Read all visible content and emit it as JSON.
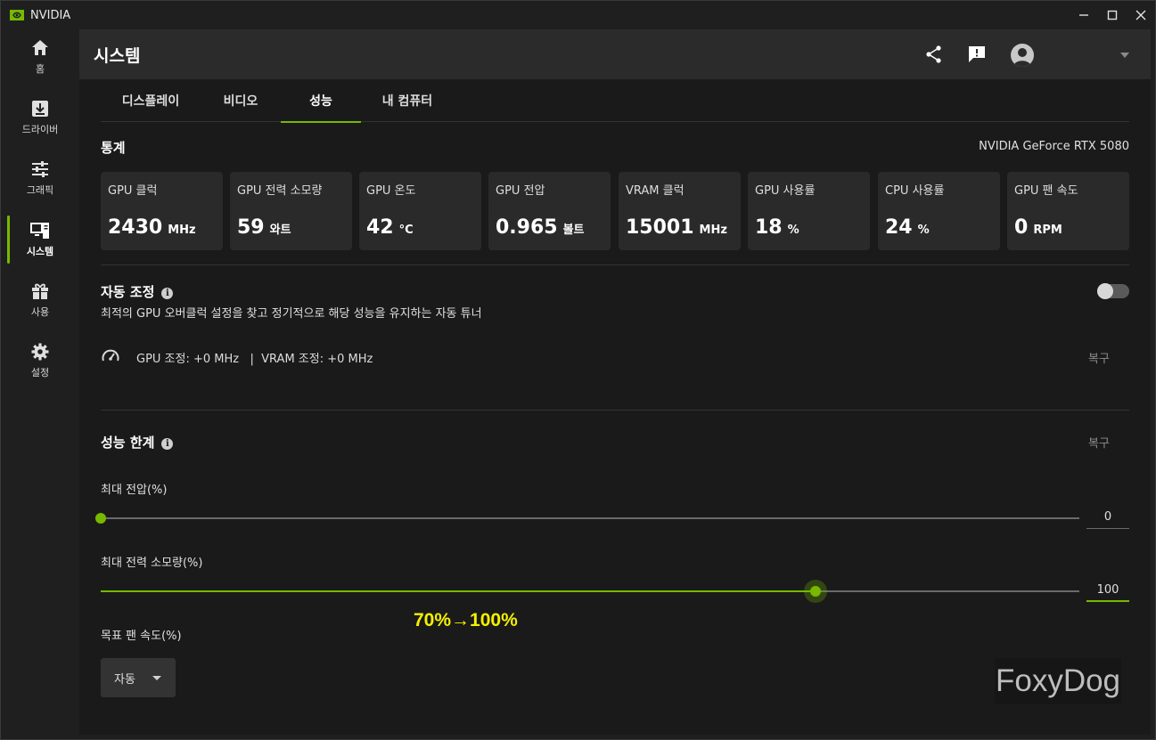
{
  "window": {
    "title": "NVIDIA",
    "controls": [
      "minimize",
      "maximize",
      "close"
    ]
  },
  "nav": {
    "items": [
      {
        "label": "홈",
        "icon": "home-icon",
        "active": false
      },
      {
        "label": "드라이버",
        "icon": "driver-download-icon",
        "active": false
      },
      {
        "label": "그래픽",
        "icon": "sliders-icon",
        "active": false
      },
      {
        "label": "시스템",
        "icon": "system-icon",
        "active": true
      },
      {
        "label": "사용",
        "icon": "gift-icon",
        "active": false
      },
      {
        "label": "설정",
        "icon": "gear-icon",
        "active": false
      }
    ]
  },
  "header": {
    "title": "시스템",
    "icons": [
      "share-icon",
      "feedback-icon",
      "avatar-icon",
      "chevron-down-icon"
    ]
  },
  "tabs": [
    {
      "label": "디스플레이",
      "active": false
    },
    {
      "label": "비디오",
      "active": false
    },
    {
      "label": "성능",
      "active": true
    },
    {
      "label": "내 컴퓨터",
      "active": false
    }
  ],
  "stats": {
    "title": "통계",
    "gpu_name": "NVIDIA GeForce RTX 5080",
    "cards": [
      {
        "label": "GPU 클럭",
        "value": "2430",
        "unit": "MHz"
      },
      {
        "label": "GPU 전력 소모량",
        "value": "59",
        "unit": "와트"
      },
      {
        "label": "GPU 온도",
        "value": "42",
        "unit": "°C"
      },
      {
        "label": "GPU 전압",
        "value": "0.965",
        "unit": "볼트"
      },
      {
        "label": "VRAM 클럭",
        "value": "15001",
        "unit": "MHz"
      },
      {
        "label": "GPU 사용률",
        "value": "18",
        "unit": "%"
      },
      {
        "label": "CPU 사용률",
        "value": "24",
        "unit": "%"
      },
      {
        "label": "GPU 팬 속도",
        "value": "0",
        "unit": "RPM"
      }
    ]
  },
  "auto_tune": {
    "title": "자동 조정",
    "info_glyph": "i",
    "description": "최적의 GPU 오버클럭 설정을 찾고 정기적으로 해당 성능을 유지하는 자동 튜너",
    "enabled": false,
    "status": "GPU 조정: +0 MHz   |  VRAM 조정: +0 MHz",
    "status_icon": "speedometer-icon",
    "reset_label": "복구"
  },
  "limits": {
    "title": "성능 한계",
    "info_glyph": "i",
    "reset_label": "복구",
    "max_voltage": {
      "label": "최대 전압(%)",
      "value": "0",
      "fraction": 0.0
    },
    "max_power": {
      "label": "최대 전력 소모량(%)",
      "value": "100",
      "fraction": 0.73
    },
    "fan_speed": {
      "label": "목표 팬 속도(%)",
      "selected": "자동"
    }
  },
  "annotation": "70%→100%",
  "watermark": "FoxyDog",
  "colors": {
    "accent": "#76b900",
    "annotation": "#f5f000",
    "panel": "#1a1a1a",
    "card": "#2a2a2a"
  }
}
